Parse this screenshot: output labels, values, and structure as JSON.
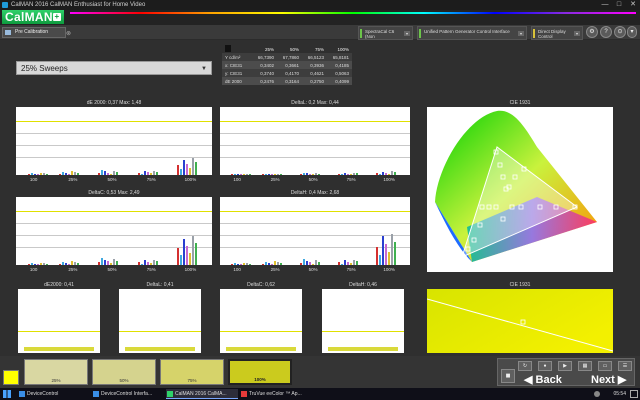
{
  "window": {
    "title": "CalMAN 2016 CalMAN Enthusiast for Home Video",
    "minimize_glyph": "—",
    "maximize_glyph": "□",
    "close_glyph": "✕"
  },
  "app": {
    "logo_text": "CalMAN",
    "logo_plus": "+"
  },
  "toolbar": {
    "workflow_tab": "Pre Calibration",
    "meter_device": "SpectraCal C6 (Non",
    "meter_device_sub": "Non)",
    "pattern_device": "Unified Pattern Generator Control Interface",
    "display_device": "Direct Display Control",
    "help_glyph": "?",
    "led_meter_color": "#6cc44a",
    "led_pattern_color": "#6cc44a",
    "led_display_color": "#d8c23a"
  },
  "sweep_select": {
    "value": "25% Sweeps"
  },
  "measure_table": {
    "headers": [
      "25%",
      "50%",
      "75%",
      "100%"
    ],
    "rows": [
      {
        "label": "Y cd/m²",
        "values": [
          "66,7390",
          "67,7860",
          "66,5123",
          "65,8181"
        ]
      },
      {
        "label": "x: CIE31",
        "values": [
          "0,3402",
          "0,3661",
          "0,3936",
          "0,4185"
        ]
      },
      {
        "label": "y: CIE31",
        "values": [
          "0,3740",
          "0,4170",
          "0,4621",
          "0,5063"
        ]
      },
      {
        "label": "dE 2000",
        "values": [
          "0,2476",
          "0,3164",
          "0,2750",
          "0,4099"
        ]
      }
    ]
  },
  "charts": {
    "de2000": {
      "title": "dE 2000: 0,37  Max: 1,48"
    },
    "deltal": {
      "title": "DeltaL: 0,2  Max: 0,44"
    },
    "deltac": {
      "title": "DeltaC: 0,53  Max: 2,49"
    },
    "deltah": {
      "title": "DeltaH: 0,4  Max: 2,68"
    },
    "x_ticks": [
      "100",
      "25%",
      "50%",
      "75%",
      "100%"
    ],
    "cie_top_title": "CIE 1931",
    "cie_bottom_title": "CIE 1931"
  },
  "single_charts": {
    "de2000": "dE2000: 0,41",
    "deltal": "DeltaL: 0,41",
    "deltac": "DeltaC: 0,62",
    "deltah": "DeltaH: 0,46"
  },
  "swatches": [
    {
      "label": "25%",
      "color": "#d9d7a2"
    },
    {
      "label": "50%",
      "color": "#d5d38e"
    },
    {
      "label": "75%",
      "color": "#d6d36a"
    },
    {
      "label": "100%",
      "color": "#cbcb1e"
    }
  ],
  "current_color": "#ffff00",
  "nav": {
    "back": "Back",
    "next": "Next"
  },
  "taskbar": {
    "items": [
      "DeviceControl",
      "DeviceControl Interfa...",
      "CalMAN 2016 CalMA...",
      "TruVue eeColor ™ Ap..."
    ],
    "time": "05:54"
  }
}
